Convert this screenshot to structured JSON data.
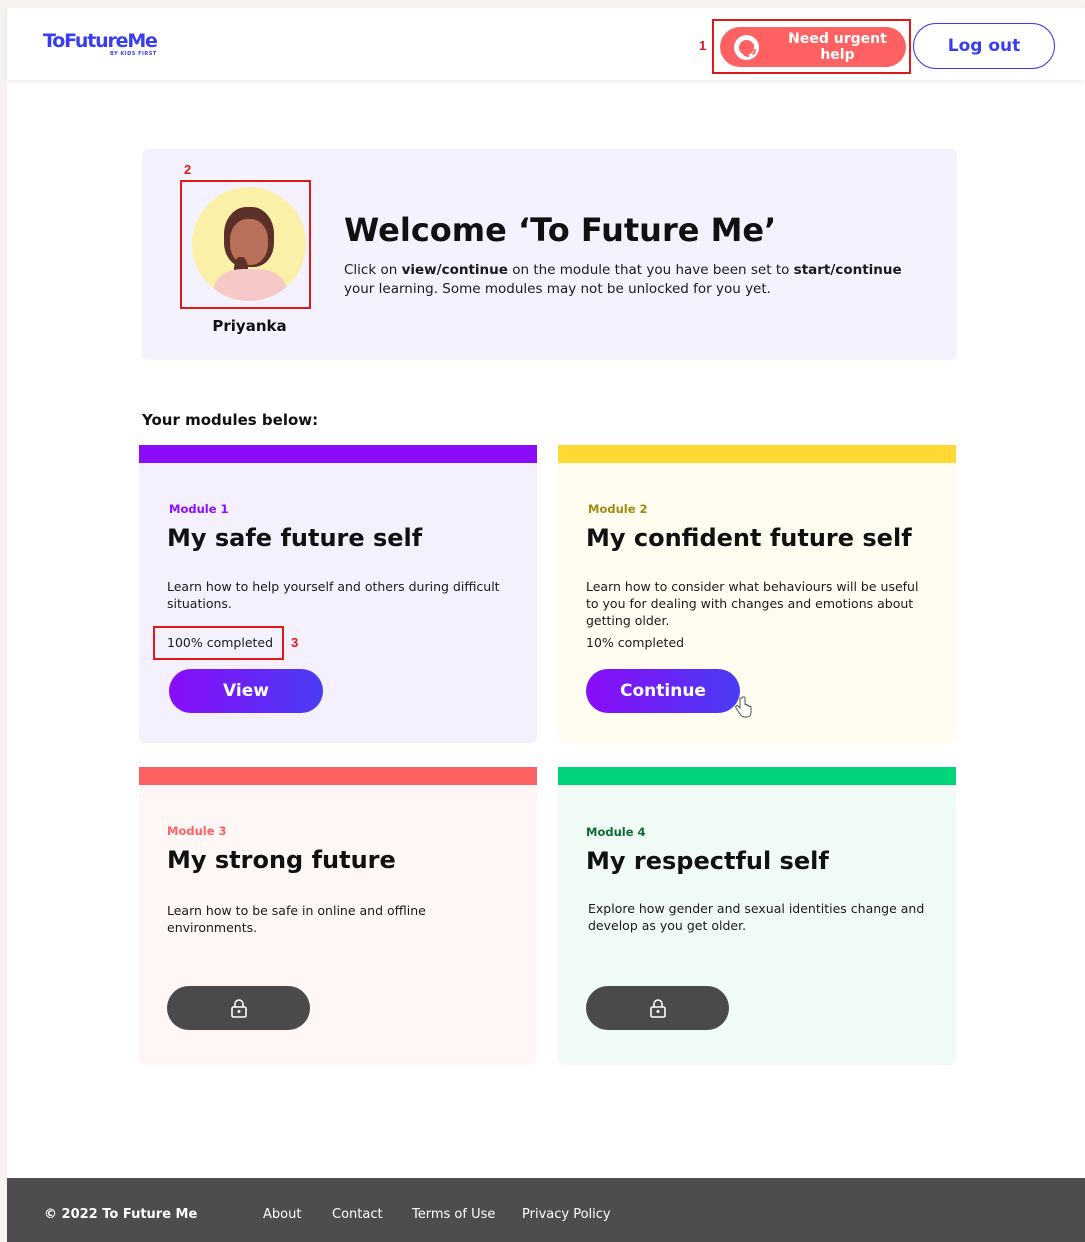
{
  "header": {
    "logo_main": "ToFutureMe",
    "logo_sub": "BY KIDS FIRST",
    "urgent_help_label": "Need urgent help",
    "logout_label": "Log out"
  },
  "annotations": [
    "1",
    "2",
    "3"
  ],
  "welcome": {
    "title": "Welcome ‘To Future Me’",
    "text_1": "Click on ",
    "text_bold_1": "view/continue",
    "text_2": " on the module that you have been set to ",
    "text_bold_2": "start/continue",
    "text_3": " your learning. Some modules may not be unlocked for you yet.",
    "username": "Priyanka"
  },
  "modules_heading": "Your modules below:",
  "modules": [
    {
      "label": "Module 1",
      "title": "My safe future self",
      "description": "Learn how to help yourself and others during difficult situations.",
      "progress_text": "100% completed",
      "progress": 100,
      "button_label": "View",
      "locked": false,
      "accent": "#8a0cf8",
      "label_color": "#8a0cf8",
      "background": "#f5f0fe"
    },
    {
      "label": "Module 2",
      "title": "My confident future self",
      "description": "Learn how to consider what behaviours will be useful to you for dealing with changes and emotions about getting older.",
      "progress_text": "10% completed",
      "progress": 10,
      "button_label": "Continue",
      "locked": false,
      "accent": "#fed835",
      "label_color": "#a08a10",
      "background": "#fffdf0"
    },
    {
      "label": "Module 3",
      "title": "My strong future",
      "description": "Learn how to be safe in online and offline environments.",
      "locked": true,
      "lock_icon": "padlock-icon",
      "accent": "#fe6162",
      "label_color": "#fe6162",
      "background": "#fff6f6"
    },
    {
      "label": "Module 4",
      "title": "My respectful self",
      "description": "Explore how gender and sexual identities change and develop as you get older.",
      "locked": true,
      "lock_icon": "padlock-icon",
      "accent": "#00d47a",
      "label_color": "#0f6a3a",
      "background": "#f0fbf5"
    }
  ],
  "footer": {
    "copyright": "© 2022 To Future Me",
    "links": [
      "About",
      "Contact",
      "Terms of Use",
      "Privacy Policy"
    ]
  }
}
